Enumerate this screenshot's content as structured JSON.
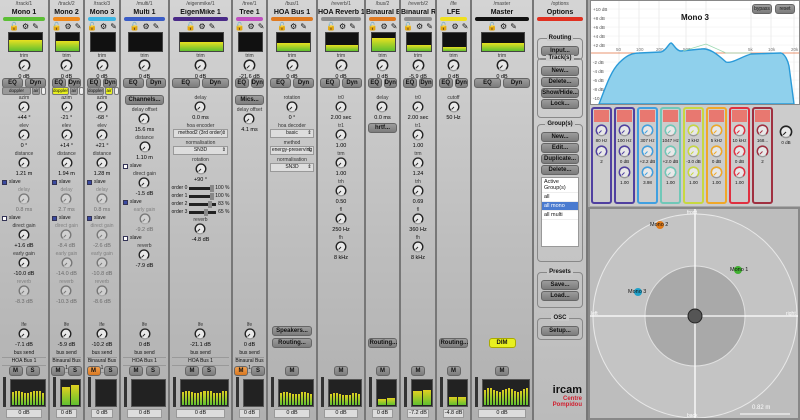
{
  "strips": [
    {
      "path": "/track/1",
      "name": "Mono 1",
      "color": "#5cbf35",
      "trim": {
        "label": "trim",
        "value": "0 dB"
      },
      "meter_top": 0.6,
      "spat": [
        "doppler",
        "air"
      ],
      "spat_active": [],
      "params": [
        {
          "kind": "knob",
          "label": "azim",
          "value": "+44 °"
        },
        {
          "kind": "knob",
          "label": "elev",
          "value": "0 °"
        },
        {
          "kind": "knob",
          "label": "distance",
          "value": "1.21 m"
        },
        {
          "kind": "check",
          "label": "slave",
          "on": true
        },
        {
          "kind": "knob",
          "label": "delay",
          "value": "0.8 ms",
          "disabled": true
        },
        {
          "kind": "check",
          "label": "slave",
          "on": false
        },
        {
          "kind": "knob",
          "label": "direct gain",
          "value": "+1.6 dB"
        },
        {
          "kind": "knob",
          "label": "early gain",
          "value": "-10.0 dB"
        },
        {
          "kind": "knob",
          "label": "reverb",
          "value": "-8.3 dB",
          "disabled": true
        },
        {
          "kind": "knob",
          "label": "lfe",
          "value": "-7.1 dB",
          "bottom": true
        }
      ],
      "bus_send": {
        "label": "bus send",
        "value": "HOA Bus 1"
      },
      "buttons": [
        "M",
        "S"
      ],
      "active": [],
      "meter": 0.6,
      "meter_value": "0 dB"
    },
    {
      "path": "/track/2",
      "name": "Mono 2",
      "color": "#f08a1c",
      "trim": {
        "label": "trim",
        "value": "0 dB"
      },
      "meter_top": 0.55,
      "spat": [
        "doppler",
        "air"
      ],
      "spat_active": [
        "doppler"
      ],
      "params": [
        {
          "kind": "knob",
          "label": "azim",
          "value": "-21 °"
        },
        {
          "kind": "knob",
          "label": "elev",
          "value": "+14 °"
        },
        {
          "kind": "knob",
          "label": "distance",
          "value": "1.94 m"
        },
        {
          "kind": "check",
          "label": "slave",
          "on": true
        },
        {
          "kind": "knob",
          "label": "delay",
          "value": "2.7 ms",
          "disabled": true
        },
        {
          "kind": "check",
          "label": "slave",
          "on": true
        },
        {
          "kind": "knob",
          "label": "direct gain",
          "value": "-8.4 dB",
          "disabled": true
        },
        {
          "kind": "knob",
          "label": "early gain",
          "value": "-14.0 dB",
          "disabled": true
        },
        {
          "kind": "knob",
          "label": "reverb",
          "value": "-10.3 dB",
          "disabled": true
        },
        {
          "kind": "knob",
          "label": "lfe",
          "value": "-5.9 dB",
          "bottom": true
        }
      ],
      "bus_send": {
        "label": "bus send",
        "value": "Binaural Bus 1"
      },
      "buttons": [
        "M",
        "S"
      ],
      "active": [],
      "meter": 0.85,
      "meter_value": "0 dB"
    },
    {
      "path": "/track/3",
      "name": "Mono 3",
      "color": "#3db6e4",
      "trim": {
        "label": "trim",
        "value": "0 dB"
      },
      "meter_top": 0,
      "spat": [
        "doppler",
        "air"
      ],
      "spat_active": [
        "air"
      ],
      "params": [
        {
          "kind": "knob",
          "label": "azim",
          "value": "-68 °"
        },
        {
          "kind": "knob",
          "label": "elev",
          "value": "+21 °"
        },
        {
          "kind": "knob",
          "label": "distance",
          "value": "1.28 m"
        },
        {
          "kind": "check",
          "label": "slave",
          "on": true
        },
        {
          "kind": "knob",
          "label": "delay",
          "value": "0.8 ms",
          "disabled": true
        },
        {
          "kind": "check",
          "label": "slave",
          "on": true
        },
        {
          "kind": "knob",
          "label": "direct gain",
          "value": "-2.6 dB",
          "disabled": true
        },
        {
          "kind": "knob",
          "label": "early gain",
          "value": "-10.8 dB",
          "disabled": true
        },
        {
          "kind": "knob",
          "label": "reverb",
          "value": "-8.6 dB",
          "disabled": true
        },
        {
          "kind": "knob",
          "label": "lfe",
          "value": "-10.2 dB",
          "bottom": true
        }
      ],
      "bus_send": {
        "label": "bus send",
        "value": "Binaural Bus 1"
      },
      "buttons": [
        "M",
        "S"
      ],
      "active": [
        "M"
      ],
      "meter": 0,
      "meter_value": "0 dB"
    },
    {
      "path": "/multi/1",
      "name": "Multi 1",
      "color": "#3a5cc6",
      "trim": {
        "label": "trim",
        "value": "0 dB"
      },
      "meter_top": 0,
      "spat": [],
      "spat_active": [],
      "params": [
        {
          "kind": "button",
          "label": "Channels..."
        },
        {
          "kind": "knob",
          "label": "delay offset",
          "value": "15.6 ms"
        },
        {
          "kind": "knob",
          "label": "distance",
          "value": "1.10 m"
        },
        {
          "kind": "check",
          "label": "slave",
          "on": false
        },
        {
          "kind": "knob",
          "label": "direct gain",
          "value": "-1.5 dB"
        },
        {
          "kind": "check",
          "label": "slave",
          "on": true
        },
        {
          "kind": "knob",
          "label": "early gain",
          "value": "-9.2 dB",
          "disabled": true
        },
        {
          "kind": "check",
          "label": "slave",
          "on": false
        },
        {
          "kind": "knob",
          "label": "reverb",
          "value": "-7.9 dB"
        },
        {
          "kind": "knob",
          "label": "lfe",
          "value": "0 dB",
          "bottom": true
        }
      ],
      "bus_send": {
        "label": "bus send",
        "value": "HOA Bus 1"
      },
      "buttons": [
        "M",
        "S"
      ],
      "active": [],
      "meter": 0,
      "meter_value": "0 dB"
    },
    {
      "path": "/eigenmike/1",
      "name": "EigenMike 1",
      "color": "#4a2a88",
      "trim": {
        "label": "trim",
        "value": "0 dB"
      },
      "meter_top": 0.5,
      "spat": [],
      "spat_active": [],
      "params": [
        {
          "kind": "knob",
          "label": "delay",
          "value": "0.0 ms"
        },
        {
          "kind": "select",
          "label": "hoa encoder",
          "value": "method2 (3rd order)"
        },
        {
          "kind": "select",
          "label": "normalisation",
          "value": "SN3D"
        },
        {
          "kind": "knob",
          "label": "rotation",
          "value": "+90 °"
        },
        {
          "kind": "slider",
          "label": "order 0",
          "value": "100 %",
          "fraction": 1.0
        },
        {
          "kind": "slider",
          "label": "order 1",
          "value": "100 %",
          "fraction": 1.0
        },
        {
          "kind": "slider",
          "label": "order 2",
          "value": "83 %",
          "fraction": 0.83
        },
        {
          "kind": "slider",
          "label": "order 3",
          "value": "65 %",
          "fraction": 0.65
        },
        {
          "kind": "knob",
          "label": "reverb",
          "value": "-4.8 dB"
        },
        {
          "kind": "knob",
          "label": "lfe",
          "value": "-21.1 dB",
          "bottom": true
        }
      ],
      "bus_send": {
        "label": "bus send",
        "value": "HOA Bus 1"
      },
      "buttons": [
        "M",
        "S"
      ],
      "active": [],
      "meter": 0.6,
      "meter_value": "0 dB"
    },
    {
      "path": "/tree/1",
      "name": "Tree 1",
      "color": "#c050c0",
      "trim": {
        "label": "trim",
        "value": "-21.6 dB"
      },
      "meter_top": 0,
      "spat": [],
      "spat_active": [],
      "params": [
        {
          "kind": "button",
          "label": "Mics..."
        },
        {
          "kind": "knob",
          "label": "delay offset",
          "value": "4.1 ms"
        },
        {
          "kind": "knob",
          "label": "lfe",
          "value": "0 dB",
          "bottom": true
        }
      ],
      "bus_send": {
        "label": "bus send",
        "value": "Binaural Bus 1"
      },
      "buttons": [
        "M",
        "S"
      ],
      "active": [
        "M"
      ],
      "meter": 0,
      "meter_value": "0 dB"
    },
    {
      "path": "/bus/1",
      "name": "HOA Bus 1",
      "color": "#e07a20",
      "trim": {
        "label": "trim",
        "value": "0 dB"
      },
      "meter_top": 0.45,
      "spat": [],
      "spat_active": [],
      "params": [
        {
          "kind": "knob",
          "label": "rotation",
          "value": "0 °"
        },
        {
          "kind": "select",
          "label": "hoa decoder",
          "value": "basic"
        },
        {
          "kind": "select",
          "label": "method",
          "value": "energy-preserving"
        },
        {
          "kind": "select",
          "label": "normalisation",
          "value": "SN3D"
        },
        {
          "kind": "button",
          "label": "Speakers...",
          "bottom": true
        },
        {
          "kind": "button",
          "label": "Routing..."
        }
      ],
      "buttons": [
        "M"
      ],
      "active": [],
      "meter": 0.55,
      "meter_value": "0 dB"
    },
    {
      "path": "/reverb/1",
      "name": "HOA Reverb 1",
      "color": "#8e8e8e",
      "trim": {
        "label": "trim",
        "value": "0 dB"
      },
      "meter_top": 0.35,
      "spat": [],
      "spat_active": [],
      "params": [
        {
          "kind": "knob",
          "label": "tr0",
          "value": "2.00 sec"
        },
        {
          "kind": "knob",
          "label": "tr1",
          "value": "1.00"
        },
        {
          "kind": "knob",
          "label": "trm",
          "value": "1.00"
        },
        {
          "kind": "knob",
          "label": "trh",
          "value": "0.50"
        },
        {
          "kind": "knob",
          "label": "fl",
          "value": "250 Hz"
        },
        {
          "kind": "knob",
          "label": "fh",
          "value": "8 kHz"
        }
      ],
      "buttons": [
        "M"
      ],
      "active": [],
      "meter": 0.5,
      "meter_value": "0 dB"
    },
    {
      "path": "/bus/2",
      "name": "Binaural Bus 1",
      "color": "#e07a20",
      "trim": {
        "label": "trim",
        "value": "0 dB"
      },
      "meter_top": 0.75,
      "spat": [],
      "spat_active": [],
      "params": [
        {
          "kind": "knob",
          "label": "delay",
          "value": "0.0 ms"
        },
        {
          "kind": "button",
          "label": "hrtf..."
        },
        {
          "kind": "button",
          "label": "Routing...",
          "bottom": true
        }
      ],
      "buttons": [
        "M"
      ],
      "active": [],
      "meter": 0.3,
      "meter_value": "0 dB"
    },
    {
      "path": "/reverb/2",
      "name": "Binaural Rev...",
      "color": "#8e8e8e",
      "trim": {
        "label": "trim",
        "value": "-5.9 dB"
      },
      "meter_top": 0.35,
      "spat": [],
      "spat_active": [],
      "params": [
        {
          "kind": "knob",
          "label": "tr0",
          "value": "2.00 sec"
        },
        {
          "kind": "knob",
          "label": "tr1",
          "value": "1.00"
        },
        {
          "kind": "knob",
          "label": "trm",
          "value": "1.24"
        },
        {
          "kind": "knob",
          "label": "trh",
          "value": "0.69"
        },
        {
          "kind": "knob",
          "label": "fl",
          "value": "360 Hz"
        },
        {
          "kind": "knob",
          "label": "fh",
          "value": "8 kHz"
        }
      ],
      "buttons": [
        "M"
      ],
      "active": [],
      "meter": 0.65,
      "meter_value": "-7.2 dB"
    },
    {
      "path": "/lfe",
      "name": "LFE",
      "color": "#f0e020",
      "trim": {
        "label": "trim",
        "value": "0 dB"
      },
      "meter_top": 0.25,
      "spat": [],
      "spat_active": [],
      "params": [
        {
          "kind": "knob",
          "label": "cutoff",
          "value": "50 Hz"
        },
        {
          "kind": "button",
          "label": "Routing...",
          "bottom": true
        }
      ],
      "buttons": [
        "M"
      ],
      "active": [],
      "meter": 0.35,
      "meter_value": "-4.8 dB"
    },
    {
      "path": "/master",
      "name": "Master",
      "color": "#111111",
      "trim": {
        "label": "trim",
        "value": "0 dB"
      },
      "meter_top": 0.45,
      "spat": [],
      "spat_active": [],
      "params": [
        {
          "kind": "dim",
          "label": "DIM",
          "bottom": true
        }
      ],
      "buttons": [
        "M"
      ],
      "active": [],
      "meter": 0.7,
      "meter_value": "0 dB"
    }
  ],
  "eq_dyn": [
    "EQ",
    "Dyn"
  ],
  "options": {
    "path": "/options",
    "name": "Options",
    "color": "#e03020",
    "routing": {
      "title": "Routing",
      "buttons": [
        "Input..."
      ]
    },
    "tracks": {
      "title": "Track(s)",
      "buttons": [
        "New...",
        "Delete...",
        "Show/Hide...",
        "Lock..."
      ]
    },
    "groups": {
      "title": "Group(s)",
      "buttons": [
        "New...",
        "Edit...",
        "Duplicate...",
        "Delete..."
      ],
      "list_header": "Active Group(s)",
      "items": [
        "all",
        "all mono",
        "all multi"
      ],
      "selected": "all mono"
    },
    "presets": {
      "title": "Presets",
      "buttons": [
        "Save...",
        "Load..."
      ]
    },
    "osc": {
      "title": "OSC",
      "buttons": [
        "Setup..."
      ]
    },
    "logo": {
      "line1": "ircam",
      "line2": "Centre",
      "line3": "Pompidou"
    }
  },
  "eq": {
    "title": "Mono 3",
    "buttons": [
      "bypass",
      "reset"
    ],
    "db_labels": [
      "+10 dB",
      "+8 dB",
      "+6 dB",
      "+4 dB",
      "+2 dB",
      "-2 dB",
      "-4 dB",
      "-6 dB",
      "-8 dB",
      "-10 dB"
    ],
    "freq_labels": [
      "50",
      "100",
      "200",
      "500",
      "1k",
      "5k",
      "10k",
      "20k"
    ],
    "bands": [
      {
        "color": "#5040a0",
        "freq": "80 Hz",
        "gain": "2",
        "q": ""
      },
      {
        "color": "#5040a0",
        "freq": "100 Hz",
        "gain": "0 dB",
        "q": "1.00"
      },
      {
        "color": "#40a0e0",
        "freq": "307 Hz",
        "gain": "+2.2 dB",
        "q": "3.98"
      },
      {
        "color": "#70c8b8",
        "freq": "1047 Hz",
        "gain": "+2.0 dB",
        "q": "1.00"
      },
      {
        "color": "#c8d840",
        "freq": "2 kHz",
        "gain": "-3.0 dB",
        "q": "1.00"
      },
      {
        "color": "#f0a828",
        "freq": "5 kHz",
        "gain": "0 dB",
        "q": "1.00"
      },
      {
        "color": "#e03040",
        "freq": "10 kHz",
        "gain": "0 dB",
        "q": "1.00"
      },
      {
        "color": "#a03040",
        "freq": "168...",
        "gain": "2",
        "q": ""
      }
    ],
    "output": "0 dB"
  },
  "spatial": {
    "front": "front",
    "back": "back",
    "left": "left",
    "right": "right",
    "scale": "0.82 m",
    "sources": [
      {
        "name": "Mono 1",
        "color": "#40b030"
      },
      {
        "name": "Mono 2",
        "color": "#e07a18"
      },
      {
        "name": "Mono 3",
        "color": "#20a0c8"
      }
    ]
  }
}
